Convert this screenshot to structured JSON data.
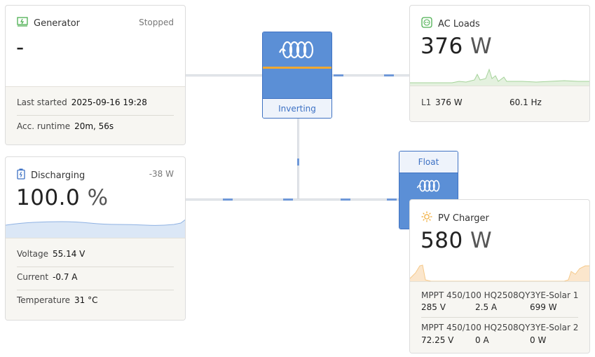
{
  "generator": {
    "title": "Generator",
    "status": "Stopped",
    "value": "-",
    "last_started_label": "Last started",
    "last_started_value": "2025-09-16 19:28",
    "runtime_label": "Acc. runtime",
    "runtime_value": "20m, 56s"
  },
  "battery": {
    "title": "Discharging",
    "power": "-38 W",
    "soc": "100.0",
    "soc_unit": "%",
    "voltage_label": "Voltage",
    "voltage_value": "55.14 V",
    "current_label": "Current",
    "current_value": "-0.7 A",
    "temperature_label": "Temperature",
    "temperature_value": "31 °C"
  },
  "inverter": {
    "state": "Inverting"
  },
  "charger_device": {
    "state": "Float"
  },
  "ac_loads": {
    "title": "AC Loads",
    "value": "376",
    "unit": "W",
    "phase_label": "L1",
    "phase_power": "376 W",
    "frequency": "60.1 Hz"
  },
  "pv_charger": {
    "title": "PV Charger",
    "value": "580",
    "unit": "W",
    "chargers": [
      {
        "name": "MPPT 450/100 HQ2508QY3YE-Solar 1",
        "voltage": "285 V",
        "current": "2.5 A",
        "power": "699 W"
      },
      {
        "name": "MPPT 450/100 HQ2508QY3YE-Solar 2",
        "voltage": "72.25 V",
        "current": "0 A",
        "power": "0 W"
      }
    ]
  },
  "colors": {
    "accent_blue": "#5b8fd6",
    "battery_fill": "#dbe7f6",
    "loads_fill": "#e4f1df",
    "solar_fill": "#fbe6cc",
    "divider_orange": "#f0a830"
  }
}
